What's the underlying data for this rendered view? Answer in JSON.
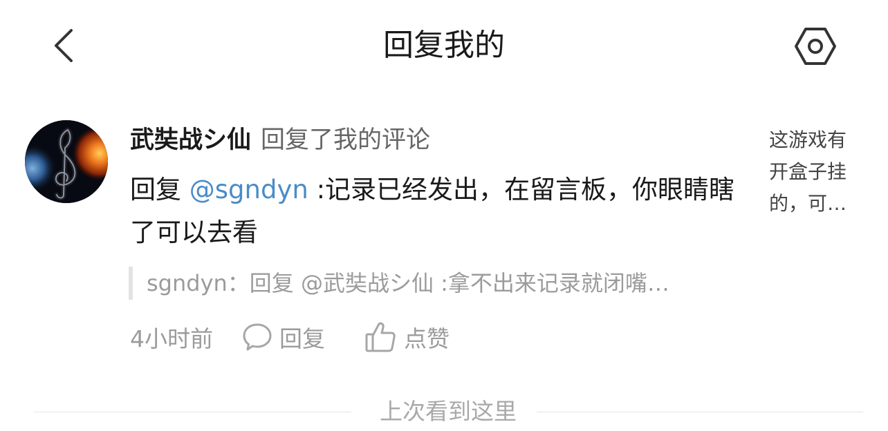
{
  "header": {
    "title": "回复我的",
    "back_icon": "chevron-left-icon",
    "settings_icon": "hexagon-settings-icon"
  },
  "notification": {
    "username": "武奘战シ仙",
    "action": "回复了我的评论",
    "reply_prefix": "回复 ",
    "mention": "@sgndyn",
    "reply_text": " :记录已经发出，在留言板，你眼睛瞎了可以去看",
    "quote": "sgndyn：回复 @武奘战シ仙 :拿不出来记录就闭嘴…",
    "time": "4小时前",
    "reply_label": "回复",
    "like_label": "点赞",
    "original_snippet_lines": [
      "这游戏有",
      "开盒子挂",
      "的，可…"
    ]
  },
  "divider": {
    "label": "上次看到这里"
  },
  "colors": {
    "mention": "#4a8cc7",
    "muted": "#9b9b9b",
    "text": "#1a1a1a"
  }
}
